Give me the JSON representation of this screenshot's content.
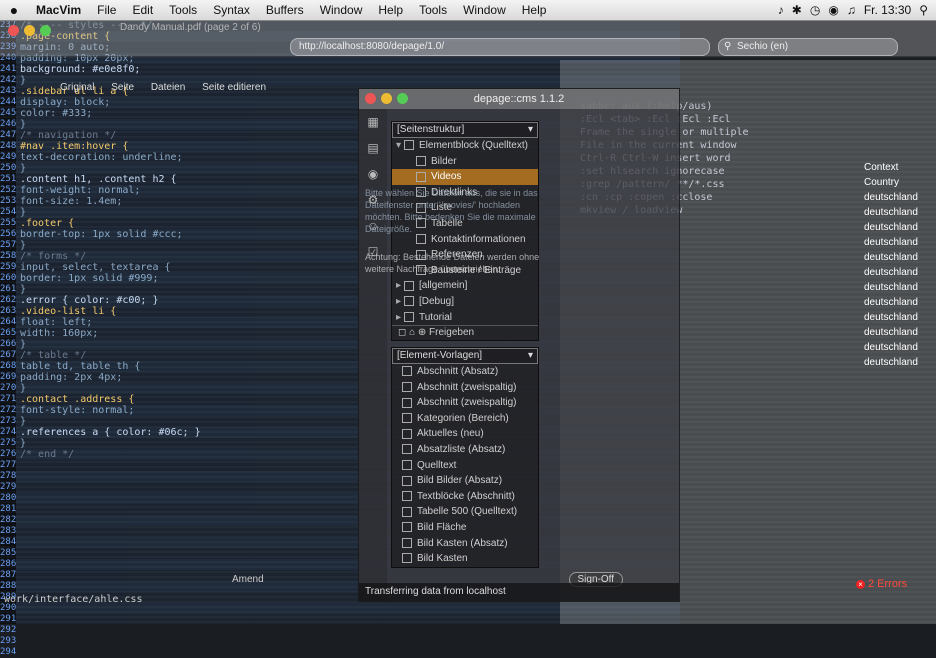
{
  "menubar": {
    "apple_icon": "apple-logo-icon",
    "items": [
      "MacVim",
      "File",
      "Edit",
      "Tools",
      "Syntax",
      "Buffers",
      "Window",
      "Help",
      "Tools",
      "Window",
      "Help"
    ],
    "clock": "Fr. 13:30"
  },
  "browser": {
    "url": "http://localhost:8080/depage/1.0/",
    "search_placeholder": "Sechio (en)",
    "toolbar": [
      "Griginal",
      "Seite",
      "Dateien",
      "Seite editieren"
    ],
    "pdf_title": "Dandy Manual.pdf (page 2 of 6)"
  },
  "cms": {
    "title": "depage::cms 1.1.2",
    "pages_panel_title": "[Seitenstruktur]",
    "pages_tree": [
      {
        "label": "Elementblock (Quelltext)",
        "level": 0,
        "twisty": "▾",
        "selected": false
      },
      {
        "label": "Bilder",
        "level": 1,
        "twisty": "",
        "selected": false
      },
      {
        "label": "Videos",
        "level": 1,
        "twisty": "",
        "selected": true
      },
      {
        "label": "Direktlinks",
        "level": 1,
        "twisty": "",
        "selected": false
      },
      {
        "label": "Liste",
        "level": 1,
        "twisty": "",
        "selected": false
      },
      {
        "label": "Tabelle",
        "level": 1,
        "twisty": "",
        "selected": false
      },
      {
        "label": "Kontaktinformationen",
        "level": 1,
        "twisty": "",
        "selected": false
      },
      {
        "label": "Referenzen",
        "level": 1,
        "twisty": "",
        "selected": false
      },
      {
        "label": "Bausteine / Einträge",
        "level": 1,
        "twisty": "",
        "selected": false
      },
      {
        "label": "[allgemein]",
        "level": 0,
        "twisty": "▸",
        "selected": false
      },
      {
        "label": "[Debug]",
        "level": 0,
        "twisty": "▸",
        "selected": false
      },
      {
        "label": "Tutorial",
        "level": 0,
        "twisty": "▸",
        "selected": false
      }
    ],
    "pages_toolbar": "◻ ⌂ ⊕  Freigeben",
    "templates_panel_title": "[Element-Vorlagen]",
    "templates": [
      "Abschnitt (Absatz)",
      "Abschnitt (zweispaltig)",
      "Abschnitt (zweispaltig)",
      "Kategorien (Bereich)",
      "Aktuelles (neu)",
      "Absatzliste (Absatz)",
      "Quelltext",
      "Bild Bilder (Absatz)",
      "Textblöcke (Abschnitt)",
      "Tabelle 500 (Quelltext)",
      "Bild Fläche",
      "Bild Kasten (Absatz)",
      "Bild Kasten"
    ],
    "info_text": "Bitte wählen Sie Dateien aus, die sie in das Dateifenster unter '/movies/' hochladen möchten. Bitte bedenken Sie die maximale Dateigröße.",
    "warning_text": "Achtung: Bestehende Dateien werden ohne weitere Nachfrage überschrieben.",
    "status": "Transferring data from localhost",
    "signoff": "Sign-Off"
  },
  "editor": {
    "line_numbers": [
      "237",
      "238",
      "239",
      "240",
      "241",
      "242",
      "243",
      "244",
      "245",
      "246",
      "247",
      "248",
      "249",
      "250",
      "251",
      "252",
      "253",
      "254",
      "255",
      "256",
      "257",
      "258",
      "259",
      "260",
      "261",
      "262",
      "263",
      "264",
      "265",
      "266",
      "267",
      "268",
      "269",
      "270",
      "271",
      "272",
      "273",
      "274",
      "275",
      "276",
      "277",
      "278",
      "279",
      "280",
      "281",
      "282",
      "283",
      "284",
      "285",
      "286",
      "287",
      "288",
      "289",
      "290",
      "291",
      "292",
      "293",
      "294"
    ],
    "bottom_path": "work/interface/ahle.css"
  },
  "right_panel": {
    "sidebar_items": [
      "Country",
      "deutschland",
      "deutschland",
      "deutschland",
      "deutschland",
      "deutschland",
      "deutschland",
      "deutschland",
      "deutschland",
      "deutschland",
      "deutschland",
      "deutschland",
      "deutschland"
    ],
    "context_label": "Context",
    "errors": "2 Errors",
    "amend_label": "Amend"
  }
}
